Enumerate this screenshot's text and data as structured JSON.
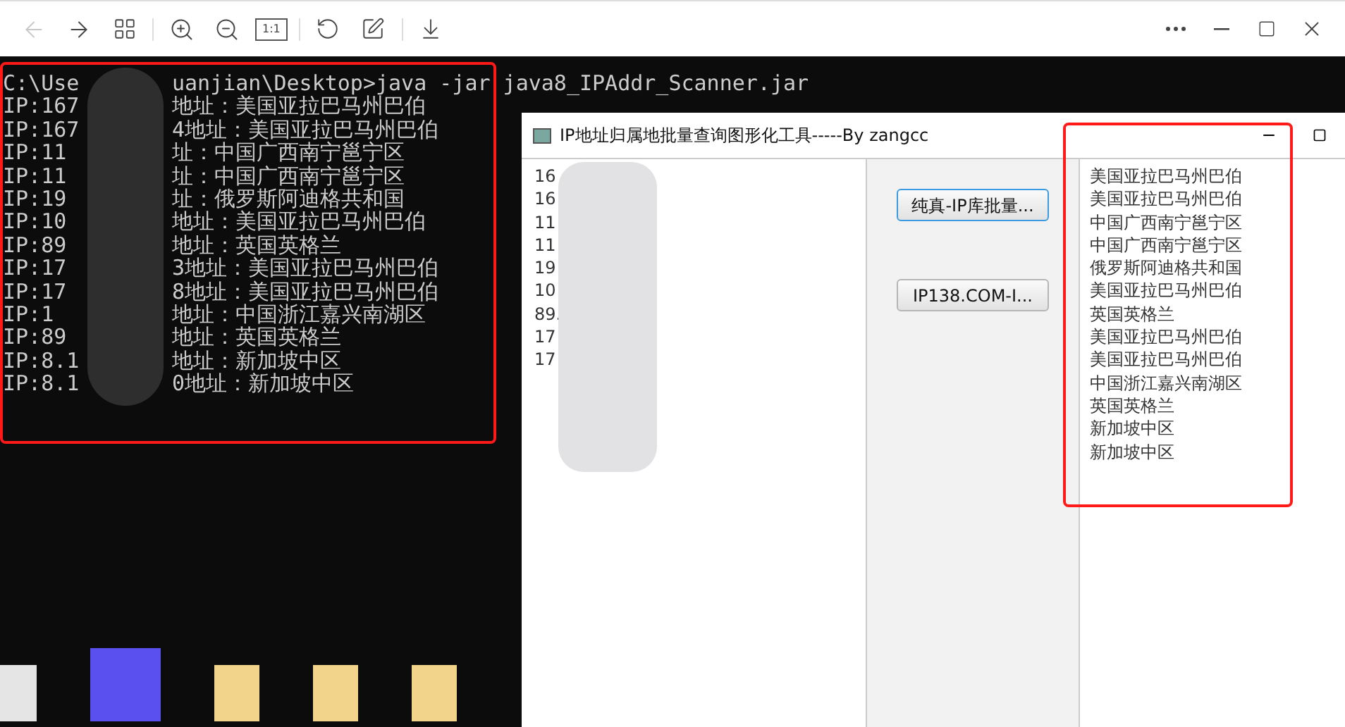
{
  "viewer_toolbar": {
    "back_disabled": true,
    "actual_size_label": "1:1"
  },
  "console": {
    "command": {
      "prefix": "C:\\Use",
      "suffix": "uanjian\\Desktop>java -jar java8_IPAddr_Scanner.jar"
    },
    "lines": [
      {
        "prefix": "IP:167",
        "suffix": "地址：美国亚拉巴马州巴伯"
      },
      {
        "prefix": "IP:167",
        "suffix": "4地址：美国亚拉巴马州巴伯"
      },
      {
        "prefix": "IP:11",
        "suffix": "址：中国广西南宁邕宁区"
      },
      {
        "prefix": "IP:11",
        "suffix": "址：中国广西南宁邕宁区"
      },
      {
        "prefix": "IP:19",
        "suffix": "址：俄罗斯阿迪格共和国"
      },
      {
        "prefix": "IP:10",
        "suffix": "地址：美国亚拉巴马州巴伯"
      },
      {
        "prefix": "IP:89",
        "suffix": "地址：英国英格兰"
      },
      {
        "prefix": "IP:17",
        "suffix": "3地址：美国亚拉巴马州巴伯"
      },
      {
        "prefix": "IP:17",
        "suffix": "8地址：美国亚拉巴马州巴伯"
      },
      {
        "prefix": "IP:1",
        "suffix": "地址：中国浙江嘉兴南湖区"
      },
      {
        "prefix": "IP:89",
        "suffix": "地址：英国英格兰"
      },
      {
        "prefix": "IP:8.1",
        "suffix": "地址：新加坡中区"
      },
      {
        "prefix": "IP:8.1",
        "suffix": "0地址：新加坡中区"
      }
    ]
  },
  "app_window": {
    "title": "IP地址归属地批量查询图形化工具-----By zangcc",
    "ip_list": [
      "16",
      "16",
      "11",
      "11",
      "19",
      "10",
      "89.",
      "17",
      "17"
    ],
    "buttons": [
      {
        "label": "纯真-IP库批量...",
        "focused": true
      },
      {
        "label": "IP138.COM-I...",
        "focused": false
      }
    ],
    "results": [
      "美国亚拉巴马州巴伯",
      "美国亚拉巴马州巴伯",
      "中国广西南宁邕宁区",
      "中国广西南宁邕宁区",
      "俄罗斯阿迪格共和国",
      "美国亚拉巴马州巴伯",
      "英国英格兰",
      "美国亚拉巴马州巴伯",
      "美国亚拉巴马州巴伯",
      "中国浙江嘉兴南湖区",
      "英国英格兰",
      "新加坡中区",
      "新加坡中区"
    ]
  }
}
